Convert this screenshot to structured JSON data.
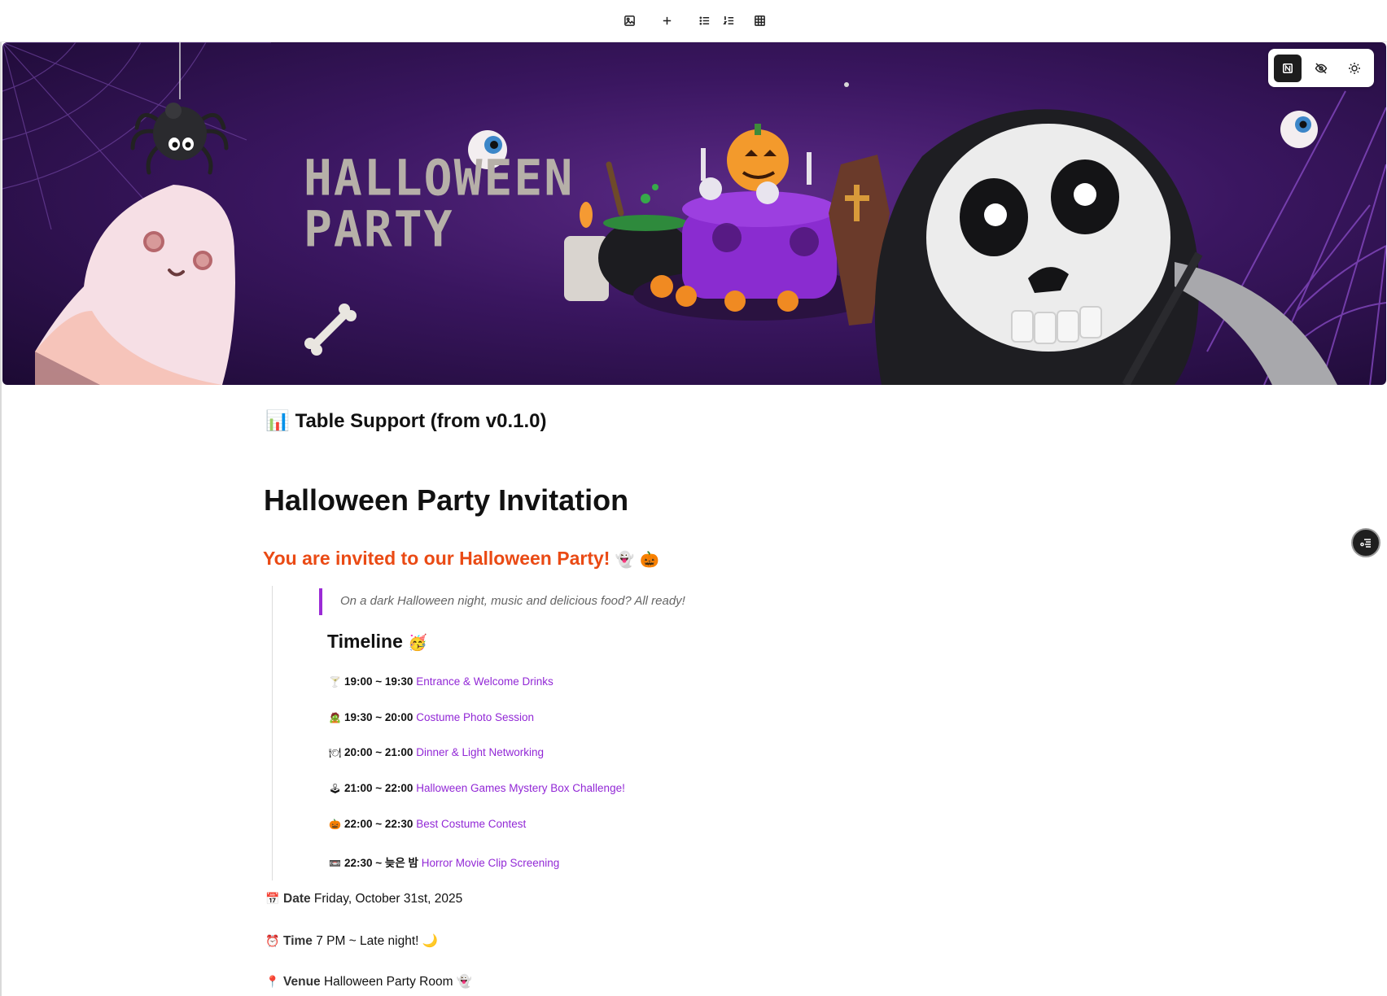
{
  "toolbar": {
    "icons": [
      "image-icon",
      "plus-icon",
      "bulleted-list-icon",
      "numbered-list-icon",
      "table-icon"
    ]
  },
  "banner": {
    "title_line1": "HALLOWEEN",
    "title_line2": "PARTY"
  },
  "mode_controls": {
    "icons": [
      "notion-icon",
      "eye-off-icon",
      "sun-icon"
    ],
    "active": "notion-icon"
  },
  "page": {
    "section_title": "Table Support (from v0.1.0)",
    "section_emoji": "📊",
    "heading": "Halloween Party Invitation",
    "invite": "You are invited to our Halloween Party!",
    "invite_emojis": "👻 🎃",
    "quote": "On a dark Halloween night, music and delicious food? All ready!",
    "timeline_title": "Timeline",
    "timeline_emoji": "🥳",
    "timeline": [
      {
        "emoji": "🍸",
        "time": "19:00 ~ 19:30",
        "desc": "Entrance & Welcome Drinks"
      },
      {
        "emoji": "🧟",
        "time": "19:30 ~ 20:00",
        "desc": "Costume Photo Session"
      },
      {
        "emoji": "🍽",
        "time": "20:00 ~ 21:00",
        "desc": "Dinner & Light Networking"
      },
      {
        "emoji": "🕹",
        "time": "21:00 ~ 22:00",
        "desc": "Halloween Games Mystery Box Challenge!"
      },
      {
        "emoji": "🎃",
        "time": "22:00 ~ 22:30",
        "desc": "Best Costume Contest"
      },
      {
        "emoji": "📼",
        "time": "22:30 ~ 늦은 밤",
        "desc": "Horror Movie Clip Screening"
      }
    ],
    "info": [
      {
        "emoji": "📅",
        "label": "Date",
        "value": "Friday, October 31st, 2025"
      },
      {
        "emoji": "⏰",
        "label": "Time",
        "value": "7 PM ~ Late night! 🌙"
      },
      {
        "emoji": "📍",
        "label": "Venue",
        "value": "Halloween Party Room 👻"
      }
    ]
  },
  "colors": {
    "accent_orange": "#ea4a14",
    "link_purple": "#9228d6",
    "quote_bar": "#9b2bd6",
    "banner_purple": "#3a1660"
  }
}
